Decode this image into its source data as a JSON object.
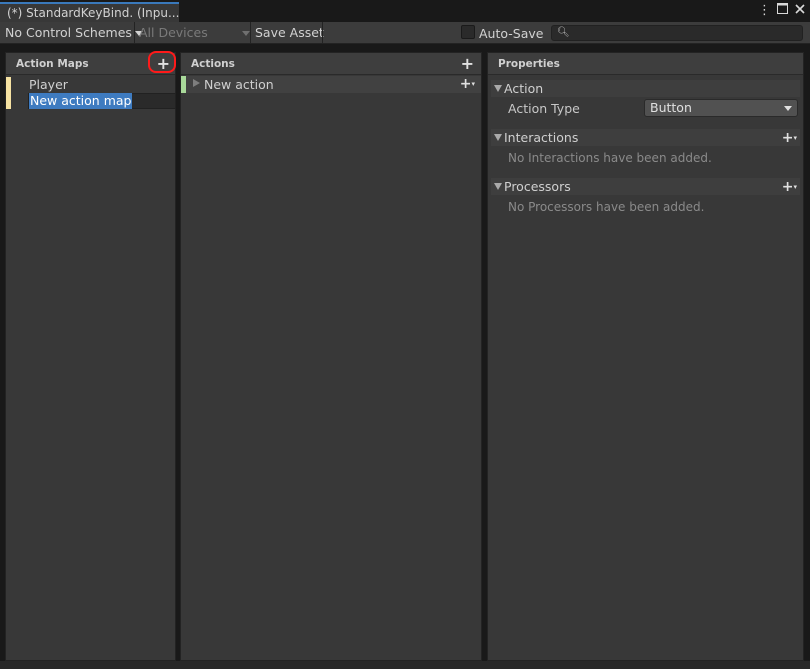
{
  "window": {
    "tab_title": "(*) StandardKeyBind. (Inpu...",
    "menu_icon": "kebab-menu-icon",
    "maximize_icon": "maximize-icon",
    "close_icon": "close-icon"
  },
  "toolbar": {
    "control_schemes": "No Control Schemes",
    "devices": "All Devices",
    "save_asset": "Save Asset",
    "auto_save_label": "Auto-Save",
    "auto_save_checked": false,
    "search_value": "",
    "search_icon": "search-icon"
  },
  "action_maps": {
    "header": "Action Maps",
    "add_icon": "plus-icon",
    "items": [
      {
        "label": "Player",
        "color": "#f6e2a2"
      },
      {
        "label": "New action map",
        "color": "#f6e2a2",
        "editing": true
      }
    ]
  },
  "actions": {
    "header": "Actions",
    "add_icon": "plus-icon",
    "items": [
      {
        "label": "New action",
        "color": "#a9d99a",
        "add_binding_icon": "plus-dropdown-icon"
      }
    ]
  },
  "properties": {
    "header": "Properties",
    "action_section": "Action",
    "action_type_label": "Action Type",
    "action_type_value": "Button",
    "interactions_section": "Interactions",
    "interactions_empty": "No Interactions have been added.",
    "processors_section": "Processors",
    "processors_empty": "No Processors have been added."
  },
  "colors": {
    "highlight_ring": "#ff1a1a",
    "selection": "#3e7bc0"
  }
}
